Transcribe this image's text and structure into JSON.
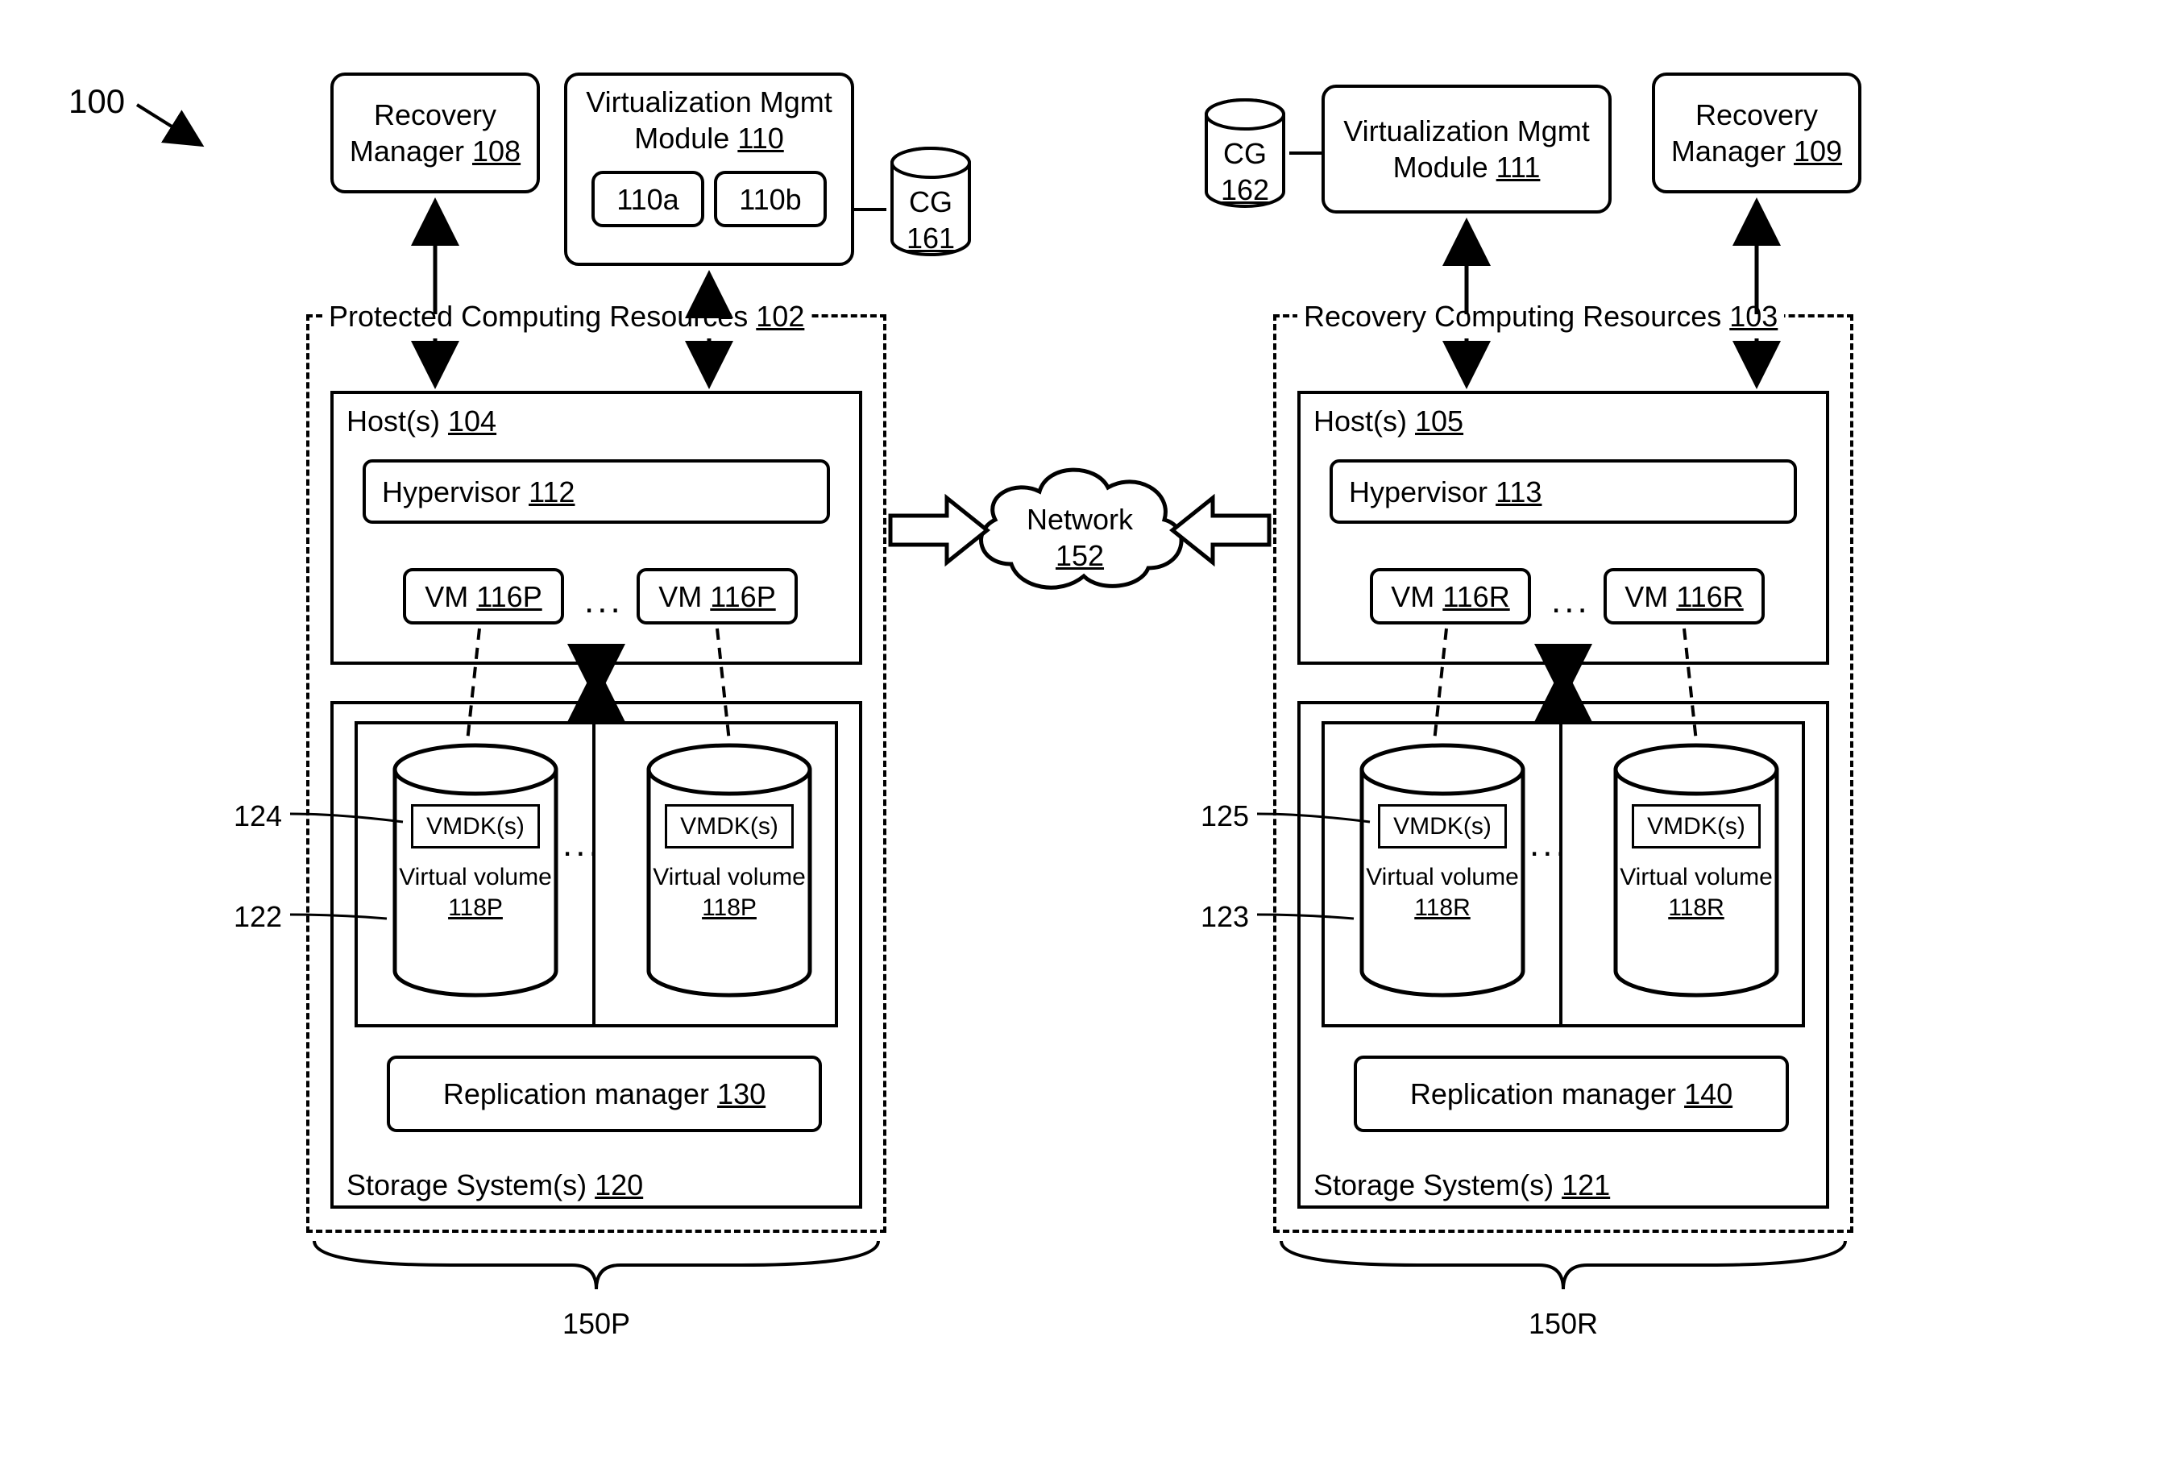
{
  "figure_ref": "100",
  "left": {
    "recoveryManager": {
      "title": "Recovery\nManager",
      "ref": "108"
    },
    "vmm": {
      "title": "Virtualization Mgmt\nModule",
      "ref": "110",
      "a": "110a",
      "b": "110b"
    },
    "cg": {
      "label": "CG",
      "ref": "161"
    },
    "resources": {
      "title": "Protected Computing Resources",
      "ref": "102"
    },
    "hosts": {
      "title": "Host(s)",
      "ref": "104"
    },
    "hypervisor": {
      "title": "Hypervisor",
      "ref": "112"
    },
    "vm": {
      "label": "VM",
      "ref": "116P"
    },
    "vmdk": {
      "label": "VMDK(s)"
    },
    "vvol": {
      "label": "Virtual volume",
      "ref": "118P"
    },
    "repl": {
      "title": "Replication manager",
      "ref": "130"
    },
    "storage": {
      "title": "Storage System(s)",
      "ref": "120"
    },
    "site": "150P",
    "callout1": "124",
    "callout2": "122"
  },
  "right": {
    "recoveryManager": {
      "title": "Recovery\nManager",
      "ref": "109"
    },
    "vmm": {
      "title": "Virtualization Mgmt\nModule",
      "ref": "111"
    },
    "cg": {
      "label": "CG",
      "ref": "162"
    },
    "resources": {
      "title": "Recovery Computing Resources",
      "ref": "103"
    },
    "hosts": {
      "title": "Host(s)",
      "ref": "105"
    },
    "hypervisor": {
      "title": "Hypervisor",
      "ref": "113"
    },
    "vm": {
      "label": "VM",
      "ref": "116R"
    },
    "vmdk": {
      "label": "VMDK(s)"
    },
    "vvol": {
      "label": "Virtual volume",
      "ref": "118R"
    },
    "repl": {
      "title": "Replication manager",
      "ref": "140"
    },
    "storage": {
      "title": "Storage System(s)",
      "ref": "121"
    },
    "site": "150R",
    "callout1": "125",
    "callout2": "123"
  },
  "network": {
    "label": "Network",
    "ref": "152"
  },
  "ellipsis": "..."
}
